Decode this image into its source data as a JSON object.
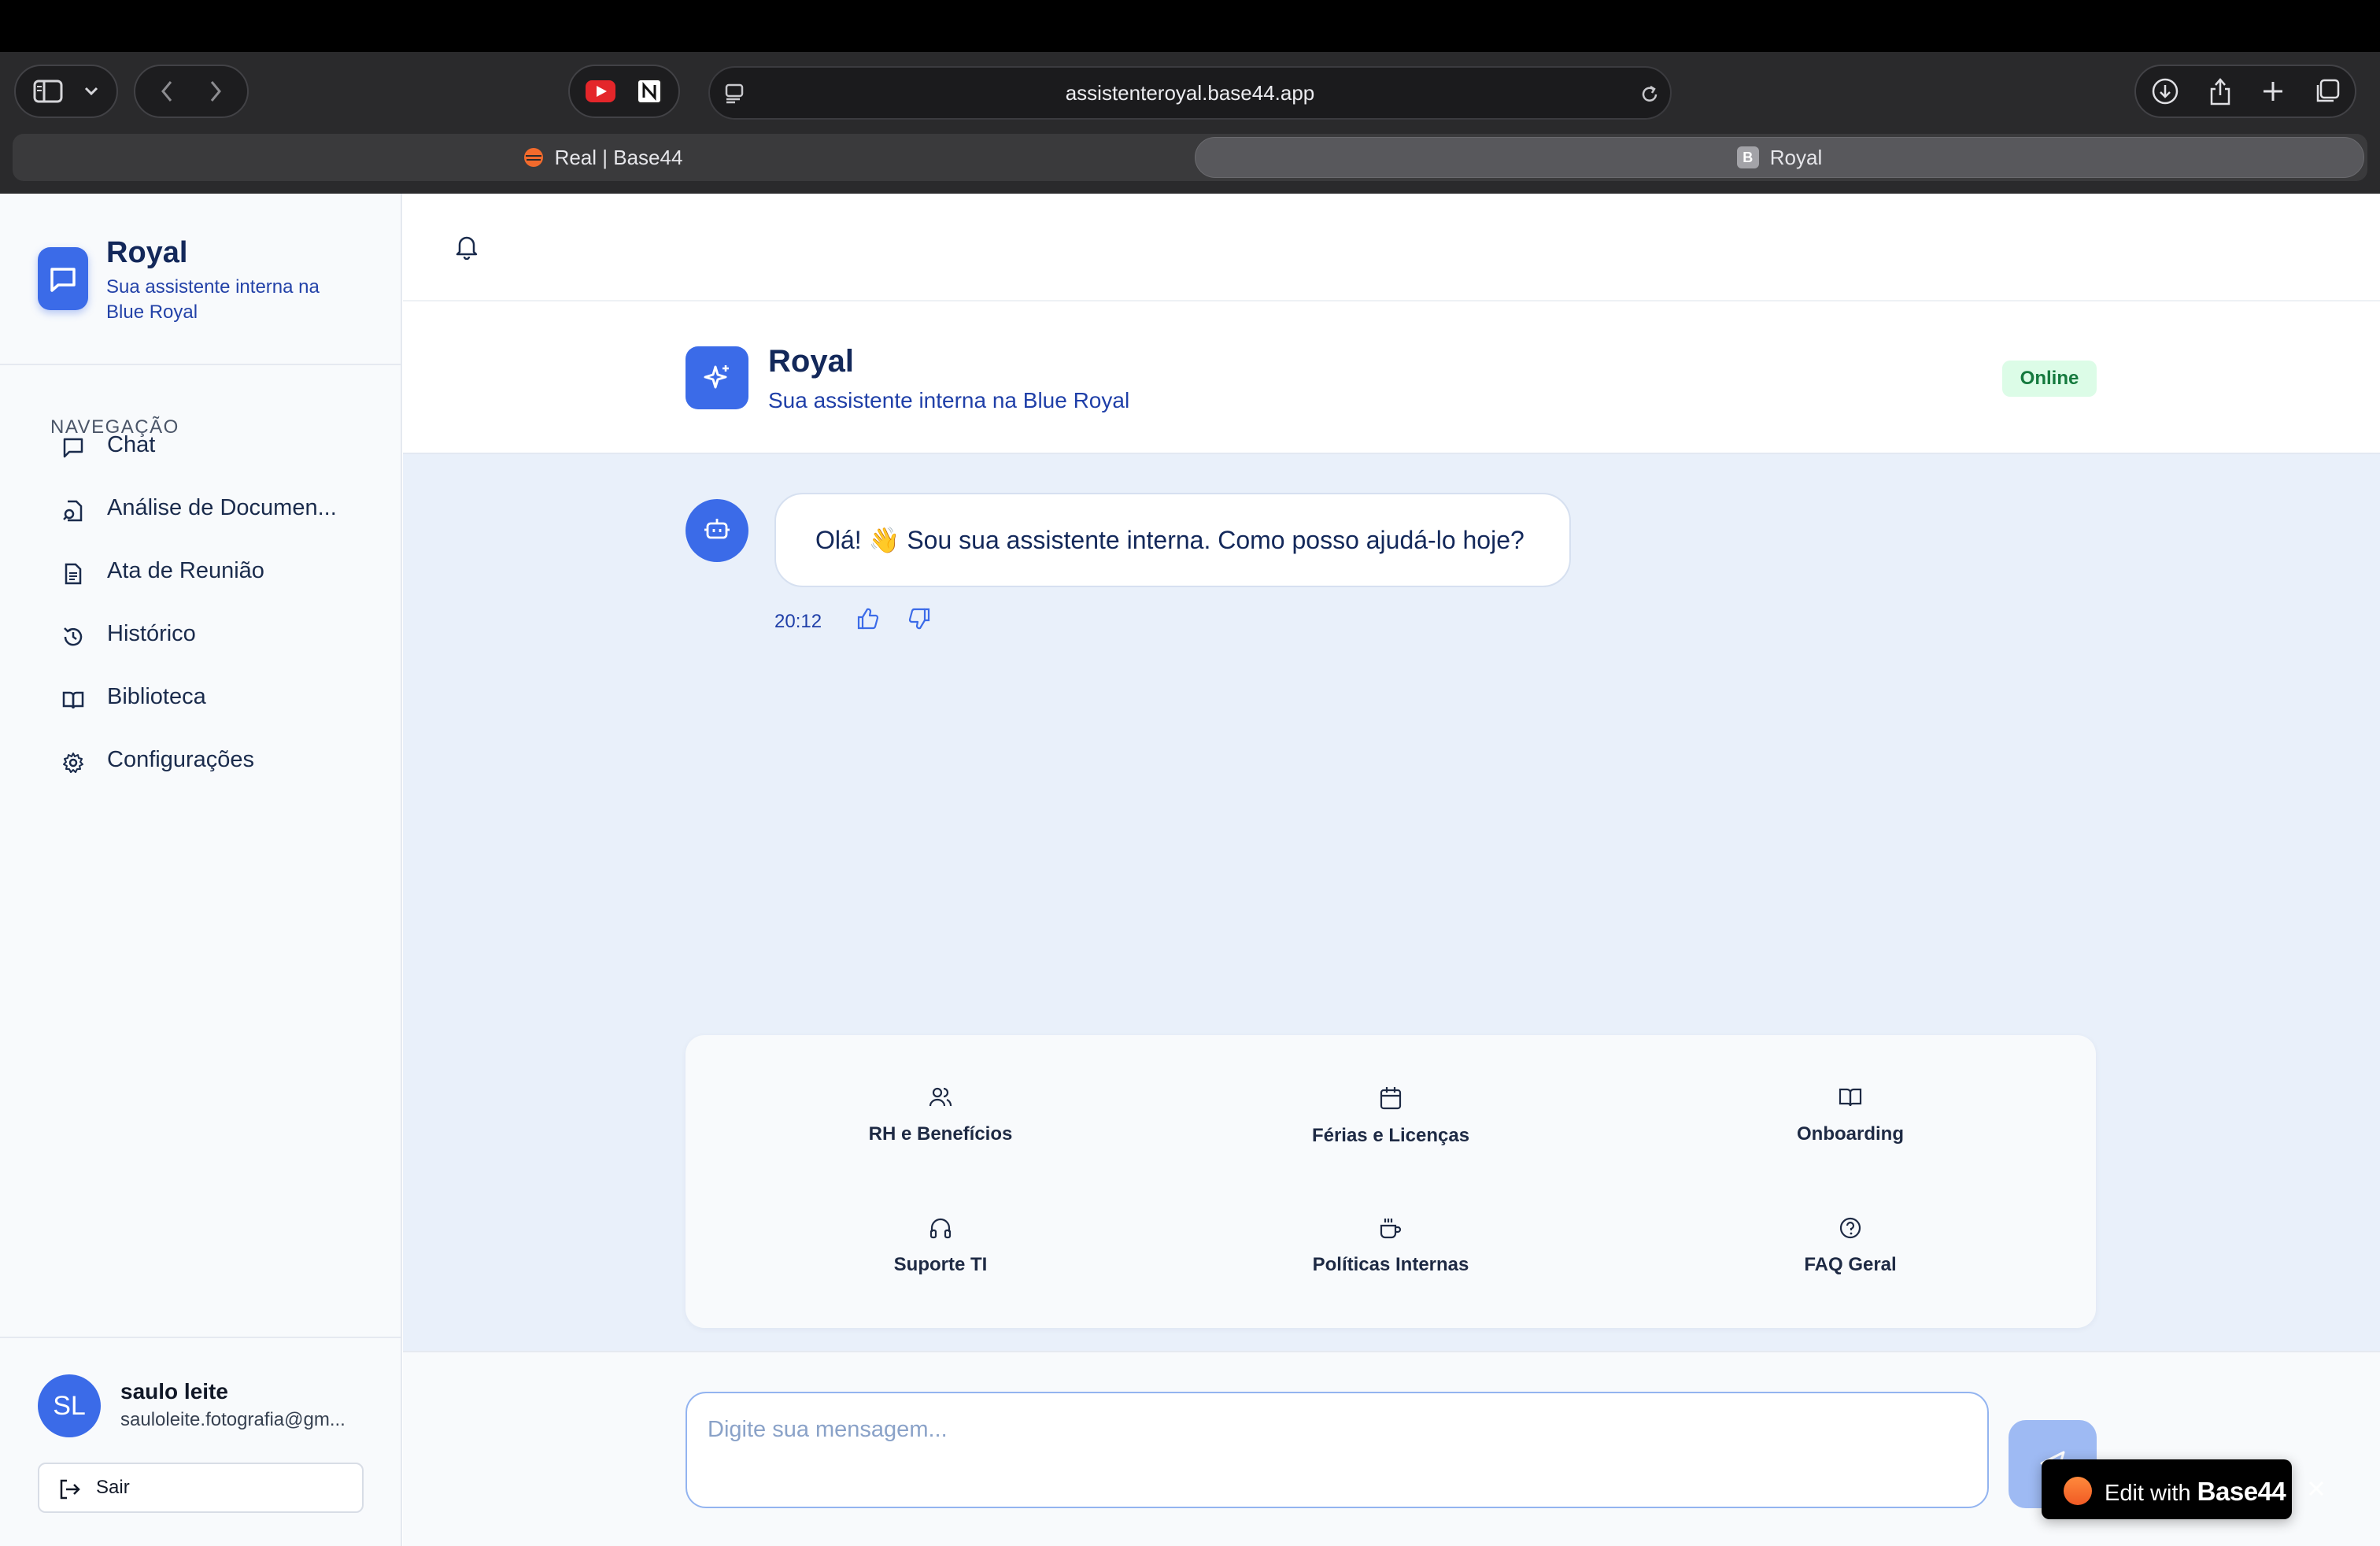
{
  "browser": {
    "url": "assistenteroyal.base44.app",
    "tabs": [
      {
        "label": "Real | Base44",
        "active": false
      },
      {
        "label": "Royal",
        "active": true,
        "favicon_letter": "B"
      }
    ]
  },
  "sidebar": {
    "brand_title": "Royal",
    "brand_subtitle": "Sua assistente interna na Blue Royal",
    "nav_heading": "NAVEGAÇÃO",
    "items": [
      {
        "label": "Chat",
        "icon": "message-square-icon"
      },
      {
        "label": "Análise de Documen...",
        "icon": "file-search-icon"
      },
      {
        "label": "Ata de Reunião",
        "icon": "file-text-icon"
      },
      {
        "label": "Histórico",
        "icon": "history-icon"
      },
      {
        "label": "Biblioteca",
        "icon": "book-open-icon"
      },
      {
        "label": "Configurações",
        "icon": "gear-icon"
      }
    ],
    "user": {
      "initials": "SL",
      "name": "saulo leite",
      "email": "sauloleite.fotografia@gm...",
      "logout_label": "Sair"
    }
  },
  "chat": {
    "title": "Royal",
    "subtitle": "Sua assistente interna na Blue Royal",
    "status": "Online",
    "messages": [
      {
        "sender": "bot",
        "text": "Olá! 👋 Sou sua assistente interna. Como posso ajudá-lo hoje?",
        "time": "20:12"
      }
    ],
    "quick_actions": [
      {
        "label": "RH e Benefícios",
        "icon": "users-icon"
      },
      {
        "label": "Férias e Licenças",
        "icon": "calendar-icon"
      },
      {
        "label": "Onboarding",
        "icon": "book-open-icon"
      },
      {
        "label": "Suporte TI",
        "icon": "headphones-icon"
      },
      {
        "label": "Políticas Internas",
        "icon": "coffee-icon"
      },
      {
        "label": "FAQ Geral",
        "icon": "help-circle-icon"
      }
    ],
    "input_placeholder": "Digite sua mensagem..."
  },
  "toast": {
    "prefix": "Edit with",
    "brand": "Base44"
  },
  "colors": {
    "accent": "#3b6be8",
    "online_badge_bg": "#dcfce7",
    "online_badge_text": "#157a3e",
    "chat_background": "#e9f0fa"
  }
}
